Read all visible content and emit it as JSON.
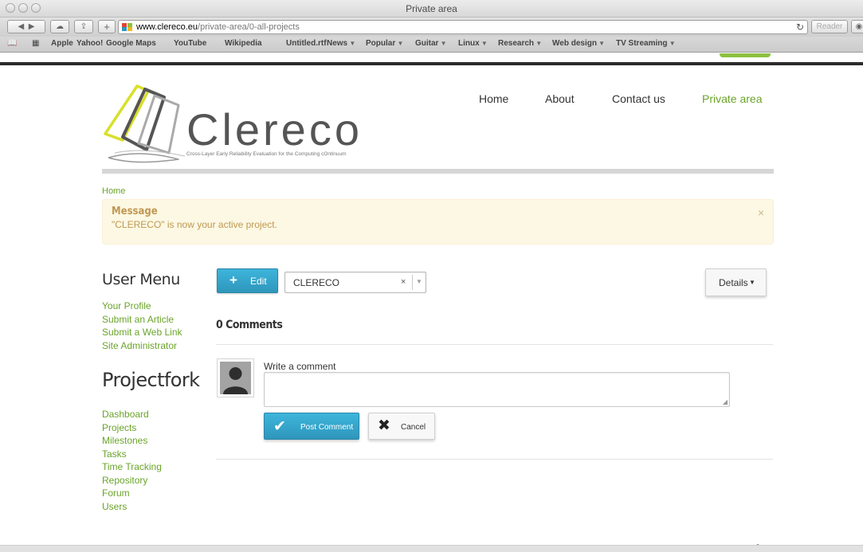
{
  "window": {
    "title": "Private area"
  },
  "toolbar": {
    "url_domain": "www.clereco.eu",
    "url_path": "/private-area/0-all-projects",
    "reader_label": "Reader",
    "reload_glyph": "↻"
  },
  "bookmarks": [
    {
      "label": "Apple",
      "menu": false
    },
    {
      "label": "Yahoo!",
      "menu": false
    },
    {
      "label": "Google Maps",
      "menu": false
    },
    {
      "label": "YouTube",
      "menu": false
    },
    {
      "label": "Wikipedia",
      "menu": false
    },
    {
      "label": "Untitled.rtf",
      "menu": false
    },
    {
      "label": "News",
      "menu": true
    },
    {
      "label": "Popular",
      "menu": true
    },
    {
      "label": "Guitar",
      "menu": true
    },
    {
      "label": "Linux",
      "menu": true
    },
    {
      "label": "Research",
      "menu": true
    },
    {
      "label": "Web design",
      "menu": true
    },
    {
      "label": "TV Streaming",
      "menu": true
    }
  ],
  "site": {
    "logo_text": "Clereco",
    "logo_tagline": "Cross-Layer Early Reliability Evaluation for the Computing cOntinuum",
    "nav": [
      {
        "label": "Home",
        "active": false
      },
      {
        "label": "About",
        "active": false
      },
      {
        "label": "Contact us",
        "active": false
      },
      {
        "label": "Private area",
        "active": true
      }
    ],
    "accent_color": "#6aa429",
    "button_blue": "#34a3c9"
  },
  "breadcrumb": "Home",
  "message": {
    "title": "Message",
    "text": "\"CLERECO\" is now your active project.",
    "close": "×"
  },
  "sidebar": {
    "user_menu_title": "User Menu",
    "user_menu": [
      "Your Profile",
      "Submit an Article",
      "Submit a Web Link",
      "Site Administrator"
    ],
    "projectfork_title": "Projectfork",
    "projectfork": [
      "Dashboard",
      "Projects",
      "Milestones",
      "Tasks",
      "Time Tracking",
      "Repository",
      "Forum",
      "Users"
    ]
  },
  "main": {
    "edit_button": "Edit",
    "project_select_value": "CLERECO",
    "details_button": "Details",
    "comments_heading": "0 Comments",
    "write_label": "Write a comment",
    "post_button": "Post Comment",
    "cancel_button": "Cancel"
  }
}
